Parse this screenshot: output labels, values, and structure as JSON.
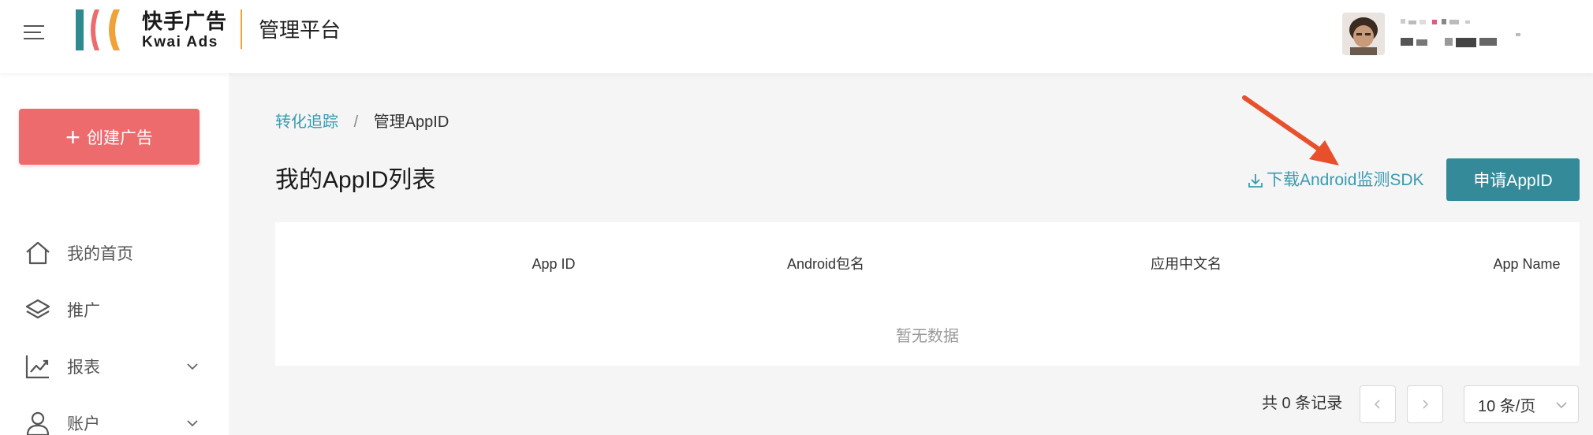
{
  "header": {
    "logo_cn": "快手广告",
    "logo_en": "Kwai Ads",
    "platform_title": "管理平台",
    "colors": {
      "logo_teal": "#2f8a8f",
      "logo_red": "#ee6b6d",
      "logo_orange": "#f0a23a"
    }
  },
  "sidebar": {
    "create_button": "创建广告",
    "items": [
      {
        "label": "我的首页",
        "icon": "home-icon",
        "expandable": false
      },
      {
        "label": "推广",
        "icon": "layers-icon",
        "expandable": false
      },
      {
        "label": "报表",
        "icon": "chart-icon",
        "expandable": true
      },
      {
        "label": "账户",
        "icon": "user-icon",
        "expandable": true
      }
    ]
  },
  "breadcrumb": {
    "parent": "转化追踪",
    "separator": "/",
    "current": "管理AppID"
  },
  "main": {
    "title": "我的AppID列表",
    "download_link": "下载Android监测SDK",
    "apply_button": "申请AppID",
    "table": {
      "columns": [
        "App ID",
        "Android包名",
        "应用中文名",
        "App Name"
      ],
      "rows": [],
      "empty_text": "暂无数据"
    },
    "pagination": {
      "total_text": "共 0 条记录",
      "prev_icon": "chevron-left-icon",
      "next_icon": "chevron-right-icon",
      "page_size": "10 条/页"
    },
    "accent_color": "#348a99",
    "annotation_color": "#e8502c"
  }
}
